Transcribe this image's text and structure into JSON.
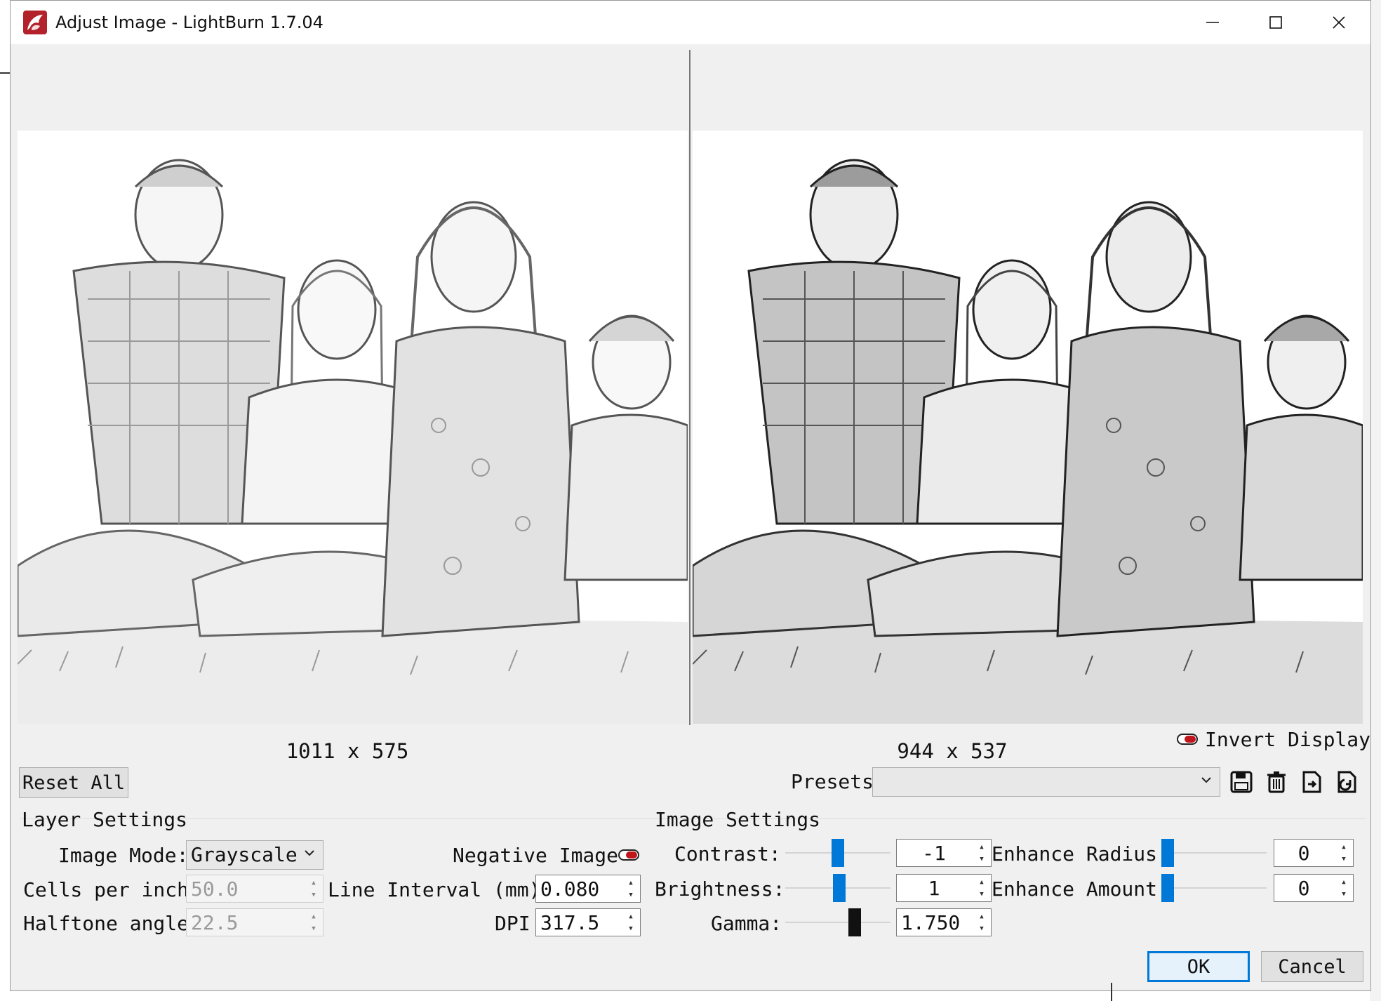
{
  "window": {
    "title": "Adjust Image - LightBurn 1.7.04"
  },
  "preview": {
    "original_dims": "1011 x 575",
    "processed_dims": "944 x 537",
    "invert_display_label": "Invert Display",
    "invert_display_on": true
  },
  "toolbar": {
    "reset_all_label": "Reset All",
    "presets_label": "Presets",
    "presets_value": "",
    "icons": [
      "save-icon",
      "delete-icon",
      "import-icon",
      "export-icon"
    ]
  },
  "layer_settings": {
    "heading": "Layer Settings",
    "image_mode_label": "Image Mode:",
    "image_mode_value": "Grayscale",
    "negative_image_label": "Negative Image",
    "negative_image_on": true,
    "cells_per_inch_label": "Cells per inch",
    "cells_per_inch_value": "50.0",
    "line_interval_label": "Line Interval (mm)",
    "line_interval_value": "0.080",
    "halftone_angle_label": "Halftone angle",
    "halftone_angle_value": "22.5",
    "dpi_label": "DPI",
    "dpi_value": "317.5"
  },
  "image_settings": {
    "heading": "Image Settings",
    "contrast_label": "Contrast:",
    "contrast_value": "-1",
    "brightness_label": "Brightness:",
    "brightness_value": "1",
    "gamma_label": "Gamma:",
    "gamma_value": "1.750",
    "enhance_radius_label": "Enhance Radius:",
    "enhance_radius_value": "0",
    "enhance_amount_label": "Enhance Amount:",
    "enhance_amount_value": "0"
  },
  "dialog_buttons": {
    "ok_label": "OK",
    "cancel_label": "Cancel"
  },
  "colors": {
    "accent": "#0078d7",
    "toggle_on": "#c0161b",
    "window_bg": "#f0f0f0"
  }
}
